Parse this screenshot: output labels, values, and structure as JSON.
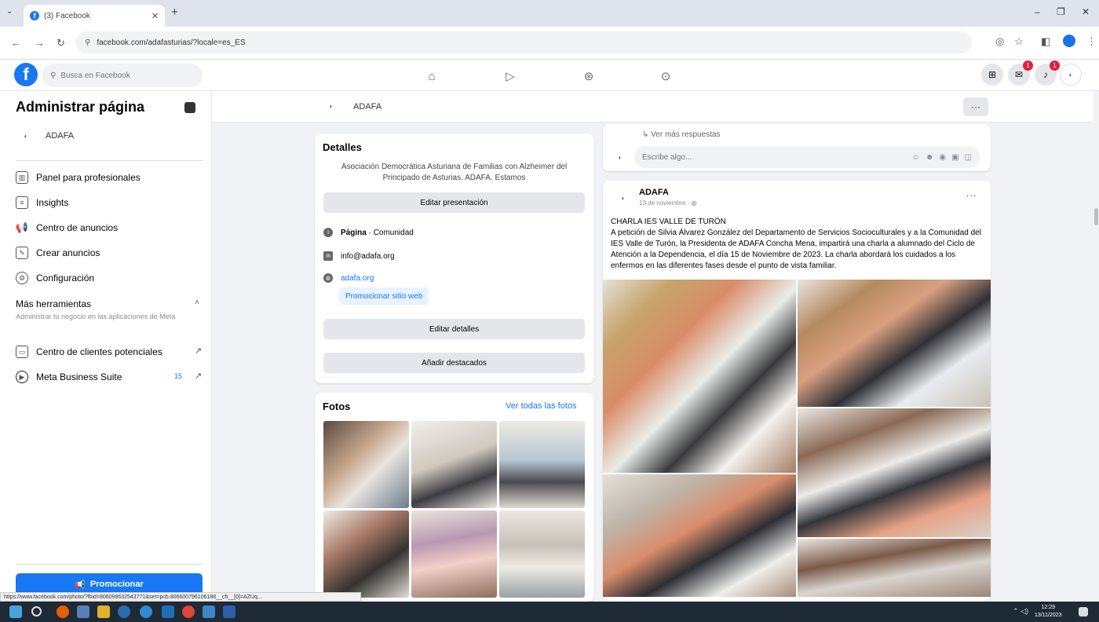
{
  "browser": {
    "tab_title": "(3) Facebook",
    "url": "facebook.com/adafasturias/?locale=es_ES",
    "status_url": "https://www.facebook.com/photo/?fbid=806098632543771&set=pcb.806600796106188__cft__[0]=AZUq..."
  },
  "header": {
    "search_placeholder": "Busca en Facebook",
    "messenger_badge": "1",
    "notifications_badge": "1"
  },
  "sidebar": {
    "title": "Administrar página",
    "page_name": "ADAFA",
    "items": [
      {
        "label": "Panel para profesionales"
      },
      {
        "label": "Insights"
      },
      {
        "label": "Centro de anuncios"
      },
      {
        "label": "Crear anuncios"
      },
      {
        "label": "Configuración"
      }
    ],
    "more_tools_title": "Más herramientas",
    "more_tools_desc": "Administrar tu negocio en las aplicaciones de Meta",
    "leads_label": "Centro de clientes potenciales",
    "mbs_label": "Meta Business Suite",
    "mbs_count": "15",
    "promote_label": "Promocionar"
  },
  "subheader": {
    "page_name": "ADAFA",
    "more_label": "···"
  },
  "details": {
    "title": "Detalles",
    "description": "Asociación Democrática Asturiana de Familias con Alzheimer del Principado de Asturias. ADAFA. Estamos",
    "edit_presentation": "Editar presentación",
    "page_type_label": "Página",
    "page_type_value": "Comunidad",
    "email": "info@adafa.org",
    "website": "adafa.org",
    "promote_site": "Promocionar sitio web",
    "edit_details": "Editar detalles",
    "add_featured": "Añadir destacados"
  },
  "photos": {
    "title": "Fotos",
    "see_all": "Ver todas las fotos"
  },
  "comment": {
    "more_replies": "Ver más respuestas",
    "placeholder": "Escribe algo..."
  },
  "post": {
    "author": "ADAFA",
    "date": "13 de noviembre",
    "menu": "···",
    "title_line": "CHARLA IES VALLE DE TURÓN",
    "body": "A petición de Silvia Álvarez González del Departamento de Servicios Socioculturales y a la Comunidad del IES Valle de Turón, la Presidenta de ADAFA Concha Mena, impartirá una charla a alumnado del Ciclo de Atención a la Dependencia, el día 15 de Noviembre de 2023. La charla abordará los cuidados a los enfermos en las diferentes fases desde el punto de vista familiar."
  },
  "taskbar": {
    "time": "12:29",
    "date": "13/11/2023"
  }
}
